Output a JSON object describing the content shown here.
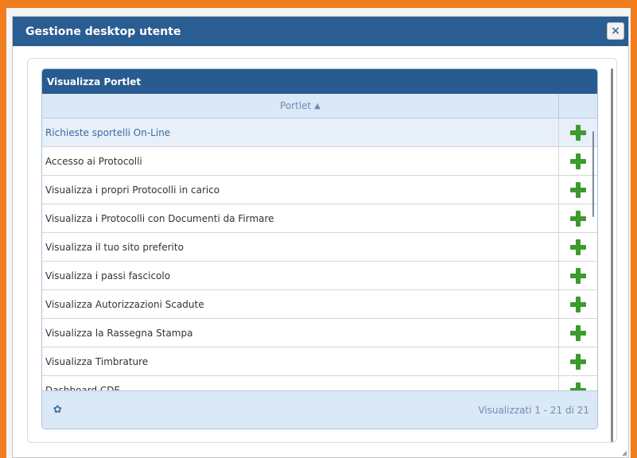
{
  "dialog": {
    "title": "Gestione desktop utente",
    "close_label": "×"
  },
  "panel": {
    "title": "Visualizza Portlet",
    "column_header": "Portlet",
    "sort_icon": "▲",
    "rows": [
      {
        "label": "Richieste sportelli On-Line",
        "selected": true
      },
      {
        "label": "Accesso ai Protocolli"
      },
      {
        "label": "Visualizza i propri Protocolli in carico"
      },
      {
        "label": "Visualizza i Protocolli con Documenti da Firmare"
      },
      {
        "label": "Visualizza il tuo sito preferito"
      },
      {
        "label": "Visualizza i passi fascicolo"
      },
      {
        "label": "Visualizza Autorizzazioni Scadute"
      },
      {
        "label": "Visualizza la Rassegna Stampa"
      },
      {
        "label": "Visualizza Timbrature"
      },
      {
        "label": "Dashboard CDE"
      }
    ],
    "footer": {
      "settings_icon": "gear-icon",
      "pager_text": "Visualizzati 1 - 21 di 21"
    }
  },
  "colors": {
    "accent": "#2a5d91",
    "frame": "#f07d1e",
    "add": "#3d9a2c"
  }
}
